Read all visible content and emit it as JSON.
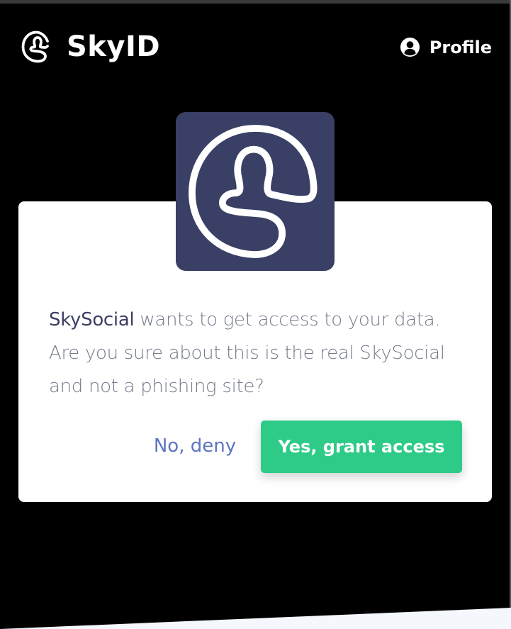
{
  "header": {
    "brand_name": "SkyID",
    "brand_icon": "skyid-logo-icon",
    "profile_label": "Profile",
    "profile_icon": "user-circle-icon"
  },
  "dialog": {
    "app_logo_icon": "skyid-logo-icon",
    "app_name": "SkySocial",
    "message_rest": " wants to get access to your data. Are you sure about this is the real SkySocial and not a phishing site?",
    "deny_label": "No, deny",
    "grant_label": "Yes, grant access"
  },
  "colors": {
    "background": "#000000",
    "card": "#ffffff",
    "app_logo_bg": "#3a3f65",
    "grant_button": "#2ecb88",
    "deny_text": "#5c74c2",
    "app_name_text": "#3b4063",
    "message_text": "#757a8c"
  }
}
